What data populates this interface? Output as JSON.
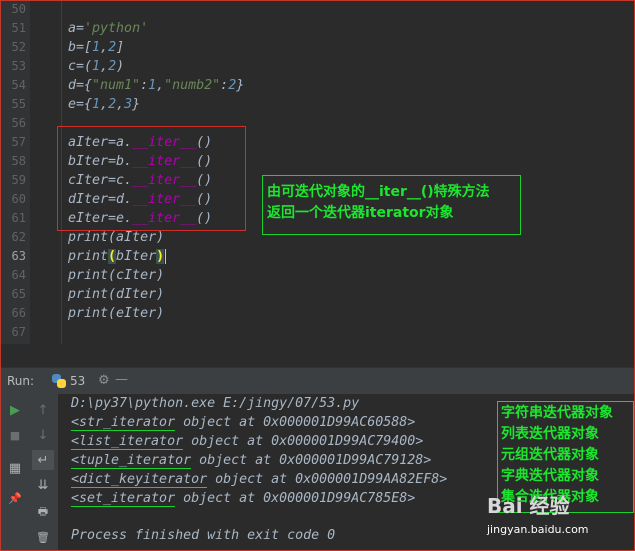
{
  "editor": {
    "current_line": "63",
    "lines": [
      {
        "num": "50",
        "tokens": []
      },
      {
        "num": "51",
        "tokens": [
          [
            "v",
            "a"
          ],
          [
            "p",
            "="
          ],
          [
            "s",
            "'python'"
          ]
        ]
      },
      {
        "num": "52",
        "tokens": [
          [
            "v",
            "b"
          ],
          [
            "p",
            "=["
          ],
          [
            "n",
            "1"
          ],
          [
            "p",
            ","
          ],
          [
            "n",
            "2"
          ],
          [
            "p",
            "]"
          ]
        ]
      },
      {
        "num": "53",
        "tokens": [
          [
            "v",
            "c"
          ],
          [
            "p",
            "=("
          ],
          [
            "n",
            "1"
          ],
          [
            "p",
            ","
          ],
          [
            "n",
            "2"
          ],
          [
            "p",
            ")"
          ]
        ]
      },
      {
        "num": "54",
        "tokens": [
          [
            "v",
            "d"
          ],
          [
            "p",
            "={"
          ],
          [
            "s",
            "\"num1\""
          ],
          [
            "p",
            ":"
          ],
          [
            "n",
            "1"
          ],
          [
            "p",
            ","
          ],
          [
            "s",
            "\"numb2\""
          ],
          [
            "p",
            ":"
          ],
          [
            "n",
            "2"
          ],
          [
            "p",
            "}"
          ]
        ]
      },
      {
        "num": "55",
        "tokens": [
          [
            "v",
            "e"
          ],
          [
            "p",
            "={"
          ],
          [
            "n",
            "1"
          ],
          [
            "p",
            ","
          ],
          [
            "n",
            "2"
          ],
          [
            "p",
            ","
          ],
          [
            "n",
            "3"
          ],
          [
            "p",
            "}"
          ]
        ]
      },
      {
        "num": "56",
        "tokens": []
      },
      {
        "num": "57",
        "tokens": [
          [
            "v",
            "aIter"
          ],
          [
            "p",
            "=a."
          ],
          [
            "m",
            "__iter__"
          ],
          [
            "p",
            "()"
          ]
        ]
      },
      {
        "num": "58",
        "tokens": [
          [
            "v",
            "bIter"
          ],
          [
            "p",
            "=b."
          ],
          [
            "m",
            "__iter__"
          ],
          [
            "p",
            "()"
          ]
        ]
      },
      {
        "num": "59",
        "tokens": [
          [
            "v",
            "cIter"
          ],
          [
            "p",
            "=c."
          ],
          [
            "m",
            "__iter__"
          ],
          [
            "p",
            "()"
          ]
        ]
      },
      {
        "num": "60",
        "tokens": [
          [
            "v",
            "dIter"
          ],
          [
            "p",
            "=d."
          ],
          [
            "m",
            "__iter__"
          ],
          [
            "p",
            "()"
          ]
        ]
      },
      {
        "num": "61",
        "tokens": [
          [
            "v",
            "eIter"
          ],
          [
            "p",
            "=e."
          ],
          [
            "m",
            "__iter__"
          ],
          [
            "p",
            "()"
          ]
        ]
      },
      {
        "num": "62",
        "tokens": [
          [
            "kw",
            "print"
          ],
          [
            "p",
            "("
          ],
          [
            "v",
            "aIter"
          ],
          [
            "p",
            ")"
          ]
        ]
      },
      {
        "num": "63",
        "tokens": [
          [
            "kw",
            "print"
          ],
          [
            "hl",
            "("
          ],
          [
            "v",
            "bIter"
          ],
          [
            "hl",
            ")"
          ]
        ]
      },
      {
        "num": "64",
        "tokens": [
          [
            "kw",
            "print"
          ],
          [
            "p",
            "("
          ],
          [
            "v",
            "cIter"
          ],
          [
            "p",
            ")"
          ]
        ]
      },
      {
        "num": "65",
        "tokens": [
          [
            "kw",
            "print"
          ],
          [
            "p",
            "("
          ],
          [
            "v",
            "dIter"
          ],
          [
            "p",
            ")"
          ]
        ]
      },
      {
        "num": "66",
        "tokens": [
          [
            "kw",
            "print"
          ],
          [
            "p",
            "("
          ],
          [
            "v",
            "eIter"
          ],
          [
            "p",
            ")"
          ]
        ]
      },
      {
        "num": "67",
        "tokens": []
      }
    ],
    "annotation": {
      "line1": "由可迭代对象的__iter__()特殊方法",
      "line2": "返回一个迭代器iterator对象"
    }
  },
  "run_panel": {
    "label": "Run:",
    "tab_name": "53",
    "gear": "⚙",
    "minimize": "—",
    "tools": {
      "run": "▶",
      "stop": "■",
      "layout": "▦",
      "pin": "📌",
      "up": "↑",
      "down": "↓",
      "wrap": "↵",
      "scroll_end": "⇊",
      "print": "🖶",
      "delete": "🗑"
    },
    "console": {
      "command": "D:\\py37\\python.exe E:/jingy/07/53.py",
      "outputs": [
        {
          "type": "<str_iterator",
          "rest": " object at 0x000001D99AC60588>"
        },
        {
          "type": "<list_iterator",
          "rest": " object at 0x000001D99AC79400>"
        },
        {
          "type": "<tuple_iterator",
          "rest": " object at 0x000001D99AC79128>"
        },
        {
          "type": "<dict_keyiterator",
          "rest": " object at 0x000001D99AA82EF8>"
        },
        {
          "type": "<set_iterator",
          "rest": " object at 0x000001D99AC785E8>"
        }
      ],
      "finished": "Process finished with exit code 0"
    },
    "annotation": [
      "字符串迭代器对象",
      "列表迭代器对象",
      "元组迭代器对象",
      "字典迭代器对象",
      "集合迭代器对象"
    ]
  },
  "watermark": {
    "logo": "Bai 经验",
    "url": "jingyan.baidu.com"
  },
  "colors": {
    "background": "#2b2b2b",
    "string": "#6a8759",
    "number": "#6897bb",
    "magic_method": "#b200b2",
    "annotation_green": "#1de62f",
    "annotation_red": "#d0302c"
  }
}
